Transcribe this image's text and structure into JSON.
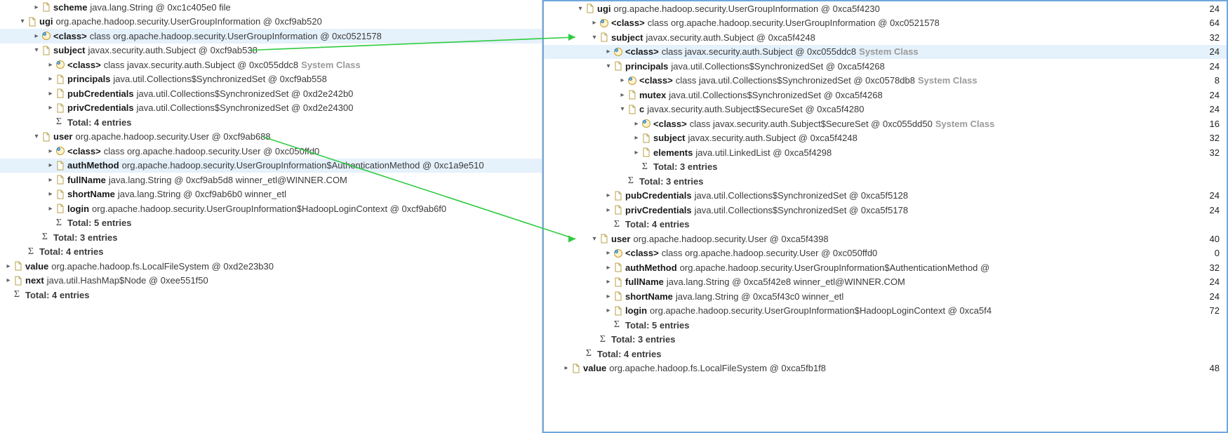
{
  "icons": {
    "file": "file-icon",
    "class": "class-icon",
    "sigma": "sigma-icon",
    "chevron_down": "chevron-down-icon",
    "chevron_right": "chevron-right-icon"
  },
  "left": {
    "rows": [
      {
        "indent": 2,
        "exp": "r",
        "icon": "file",
        "name": "scheme",
        "val": "java.lang.String @ 0xc1c405e0  file"
      },
      {
        "indent": 1,
        "exp": "d",
        "icon": "file",
        "name": "ugi",
        "val": "org.apache.hadoop.security.UserGroupInformation @ 0xcf9ab520"
      },
      {
        "indent": 2,
        "exp": "r",
        "icon": "class",
        "name": "<class>",
        "val": "class org.apache.hadoop.security.UserGroupInformation @ 0xc0521578",
        "sel": true
      },
      {
        "indent": 2,
        "exp": "d",
        "icon": "file",
        "name": "subject",
        "val": "javax.security.auth.Subject @ 0xcf9ab538",
        "link": "subject"
      },
      {
        "indent": 3,
        "exp": "r",
        "icon": "class",
        "name": "<class>",
        "val": "class javax.security.auth.Subject @ 0xc055ddc8",
        "sys": "System Class"
      },
      {
        "indent": 3,
        "exp": "r",
        "icon": "file",
        "name": "principals",
        "val": "java.util.Collections$SynchronizedSet @ 0xcf9ab558"
      },
      {
        "indent": 3,
        "exp": "r",
        "icon": "file",
        "name": "pubCredentials",
        "val": "java.util.Collections$SynchronizedSet @ 0xd2e242b0"
      },
      {
        "indent": 3,
        "exp": "r",
        "icon": "file",
        "name": "privCredentials",
        "val": "java.util.Collections$SynchronizedSet @ 0xd2e24300"
      },
      {
        "indent": 3,
        "exp": "",
        "icon": "sigma",
        "name": "",
        "val": "Total: 4 entries",
        "bold": true
      },
      {
        "indent": 2,
        "exp": "d",
        "icon": "file",
        "name": "user",
        "val": "org.apache.hadoop.security.User @ 0xcf9ab688",
        "link": "user"
      },
      {
        "indent": 3,
        "exp": "r",
        "icon": "class",
        "name": "<class>",
        "val": "class org.apache.hadoop.security.User @ 0xc050ffd0"
      },
      {
        "indent": 3,
        "exp": "r",
        "icon": "file",
        "name": "authMethod",
        "val": "org.apache.hadoop.security.UserGroupInformation$AuthenticationMethod @ 0xc1a9e510",
        "sel": true
      },
      {
        "indent": 3,
        "exp": "r",
        "icon": "file",
        "name": "fullName",
        "val": "java.lang.String @ 0xcf9ab5d8  winner_etl@WINNER.COM"
      },
      {
        "indent": 3,
        "exp": "r",
        "icon": "file",
        "name": "shortName",
        "val": "java.lang.String @ 0xcf9ab6b0  winner_etl"
      },
      {
        "indent": 3,
        "exp": "r",
        "icon": "file",
        "name": "login",
        "val": "org.apache.hadoop.security.UserGroupInformation$HadoopLoginContext @ 0xcf9ab6f0"
      },
      {
        "indent": 3,
        "exp": "",
        "icon": "sigma",
        "name": "",
        "val": "Total: 5 entries",
        "bold": true
      },
      {
        "indent": 2,
        "exp": "",
        "icon": "sigma",
        "name": "",
        "val": "Total: 3 entries",
        "bold": true
      },
      {
        "indent": 1,
        "exp": "",
        "icon": "sigma",
        "name": "",
        "val": "Total: 4 entries",
        "bold": true
      },
      {
        "indent": 0,
        "exp": "r",
        "icon": "file",
        "name": "value",
        "val": "org.apache.hadoop.fs.LocalFileSystem @ 0xd2e23b30"
      },
      {
        "indent": 0,
        "exp": "r",
        "icon": "file",
        "name": "next",
        "val": "java.util.HashMap$Node @ 0xee551f50"
      },
      {
        "indent": 0,
        "exp": "",
        "icon": "sigma",
        "name": "",
        "val": "Total: 4 entries",
        "bold": true
      }
    ]
  },
  "right": {
    "rows": [
      {
        "indent": 2,
        "exp": "d",
        "icon": "file",
        "name": "ugi",
        "val": "org.apache.hadoop.security.UserGroupInformation @ 0xca5f4230",
        "num": "24"
      },
      {
        "indent": 3,
        "exp": "r",
        "icon": "class",
        "name": "<class>",
        "val": "class org.apache.hadoop.security.UserGroupInformation @ 0xc0521578",
        "num": "64"
      },
      {
        "indent": 3,
        "exp": "d",
        "icon": "file",
        "name": "subject",
        "val": "javax.security.auth.Subject @ 0xca5f4248",
        "num": "32",
        "target": "subject"
      },
      {
        "indent": 4,
        "exp": "r",
        "icon": "class",
        "name": "<class>",
        "val": "class javax.security.auth.Subject @ 0xc055ddc8",
        "sys": "System Class",
        "num": "24",
        "sel": true
      },
      {
        "indent": 4,
        "exp": "d",
        "icon": "file",
        "name": "principals",
        "val": "java.util.Collections$SynchronizedSet @ 0xca5f4268",
        "num": "24"
      },
      {
        "indent": 5,
        "exp": "r",
        "icon": "class",
        "name": "<class>",
        "val": "class java.util.Collections$SynchronizedSet @ 0xc0578db8",
        "sys": "System Class",
        "num": "8"
      },
      {
        "indent": 5,
        "exp": "r",
        "icon": "file",
        "name": "mutex",
        "val": "java.util.Collections$SynchronizedSet @ 0xca5f4268",
        "num": "24"
      },
      {
        "indent": 5,
        "exp": "d",
        "icon": "file",
        "name": "c",
        "val": "javax.security.auth.Subject$SecureSet @ 0xca5f4280",
        "num": "24"
      },
      {
        "indent": 6,
        "exp": "r",
        "icon": "class",
        "name": "<class>",
        "val": "class javax.security.auth.Subject$SecureSet @ 0xc055dd50",
        "sys": "System Class",
        "num": "16"
      },
      {
        "indent": 6,
        "exp": "r",
        "icon": "file",
        "name": "subject",
        "val": "javax.security.auth.Subject @ 0xca5f4248",
        "num": "32"
      },
      {
        "indent": 6,
        "exp": "r",
        "icon": "file",
        "name": "elements",
        "val": "java.util.LinkedList @ 0xca5f4298",
        "num": "32"
      },
      {
        "indent": 6,
        "exp": "",
        "icon": "sigma",
        "name": "",
        "val": "Total: 3 entries",
        "bold": true
      },
      {
        "indent": 5,
        "exp": "",
        "icon": "sigma",
        "name": "",
        "val": "Total: 3 entries",
        "bold": true
      },
      {
        "indent": 4,
        "exp": "r",
        "icon": "file",
        "name": "pubCredentials",
        "val": "java.util.Collections$SynchronizedSet @ 0xca5f5128",
        "num": "24"
      },
      {
        "indent": 4,
        "exp": "r",
        "icon": "file",
        "name": "privCredentials",
        "val": "java.util.Collections$SynchronizedSet @ 0xca5f5178",
        "num": "24"
      },
      {
        "indent": 4,
        "exp": "",
        "icon": "sigma",
        "name": "",
        "val": "Total: 4 entries",
        "bold": true
      },
      {
        "indent": 3,
        "exp": "d",
        "icon": "file",
        "name": "user",
        "val": "org.apache.hadoop.security.User @ 0xca5f4398",
        "num": "40",
        "target": "user"
      },
      {
        "indent": 4,
        "exp": "r",
        "icon": "class",
        "name": "<class>",
        "val": "class org.apache.hadoop.security.User @ 0xc050ffd0",
        "num": "0"
      },
      {
        "indent": 4,
        "exp": "r",
        "icon": "file",
        "name": "authMethod",
        "val": "org.apache.hadoop.security.UserGroupInformation$AuthenticationMethod @",
        "num": "32"
      },
      {
        "indent": 4,
        "exp": "r",
        "icon": "file",
        "name": "fullName",
        "val": "java.lang.String @ 0xca5f42e8  winner_etl@WINNER.COM",
        "num": "24"
      },
      {
        "indent": 4,
        "exp": "r",
        "icon": "file",
        "name": "shortName",
        "val": "java.lang.String @ 0xca5f43c0  winner_etl",
        "num": "24"
      },
      {
        "indent": 4,
        "exp": "r",
        "icon": "file",
        "name": "login",
        "val": "org.apache.hadoop.security.UserGroupInformation$HadoopLoginContext @ 0xca5f4",
        "num": "72"
      },
      {
        "indent": 4,
        "exp": "",
        "icon": "sigma",
        "name": "",
        "val": "Total: 5 entries",
        "bold": true
      },
      {
        "indent": 3,
        "exp": "",
        "icon": "sigma",
        "name": "",
        "val": "Total: 3 entries",
        "bold": true
      },
      {
        "indent": 2,
        "exp": "",
        "icon": "sigma",
        "name": "",
        "val": "Total: 4 entries",
        "bold": true
      },
      {
        "indent": 1,
        "exp": "r",
        "icon": "file",
        "name": "value",
        "val": "org.apache.hadoop.fs.LocalFileSystem @ 0xca5fb1f8",
        "num": "48"
      }
    ]
  }
}
